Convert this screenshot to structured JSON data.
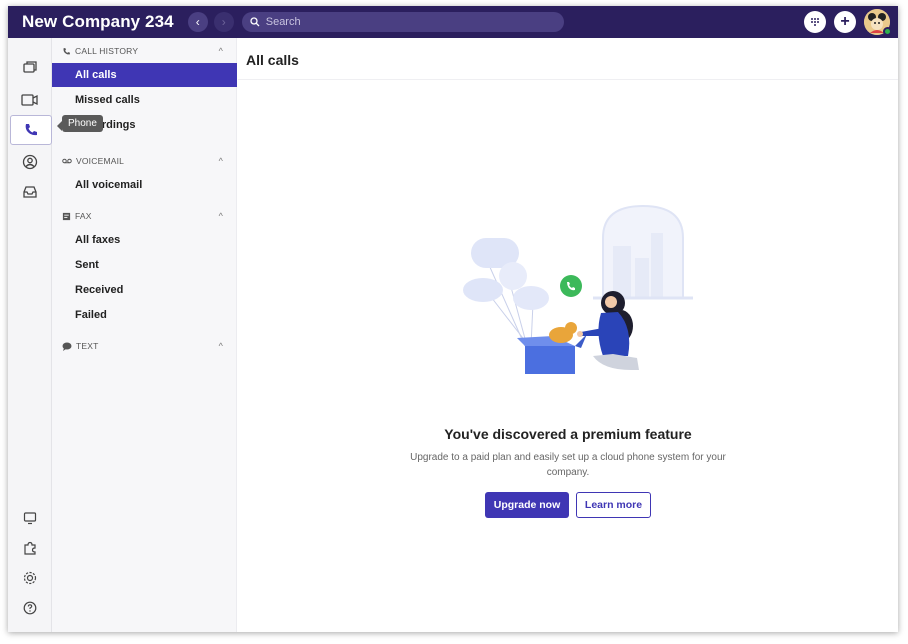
{
  "topbar": {
    "company_name": "New Company 234",
    "back_icon": "chevron-left-icon",
    "forward_icon": "chevron-right-icon",
    "search_placeholder": "Search",
    "keypad_icon": "dialpad-icon",
    "add_label": "+"
  },
  "rail": {
    "tooltip": "Phone",
    "items": [
      "chat-icon",
      "video-icon",
      "phone-icon",
      "contacts-icon",
      "inbox-icon"
    ],
    "bottom_items": [
      "display-icon",
      "puzzle-icon",
      "gear-icon",
      "help-icon"
    ]
  },
  "sidebar": {
    "call_history": {
      "title": "CALL HISTORY",
      "items": [
        "All calls",
        "Missed calls",
        "Recordings"
      ],
      "selected": "All calls"
    },
    "voicemail": {
      "title": "VOICEMAIL",
      "items": [
        "All voicemail"
      ]
    },
    "fax": {
      "title": "FAX",
      "items": [
        "All faxes",
        "Sent",
        "Received",
        "Failed"
      ]
    },
    "text": {
      "title": "TEXT"
    }
  },
  "main": {
    "title": "All calls",
    "heading": "You've discovered a premium feature",
    "subtext": "Upgrade to a paid plan and easily set up a cloud phone system for your company.",
    "primary_button": "Upgrade now",
    "secondary_button": "Learn more"
  },
  "colors": {
    "topbar": "#2b1f5e",
    "accent": "#3f36b4",
    "presence": "#2fb24c"
  }
}
